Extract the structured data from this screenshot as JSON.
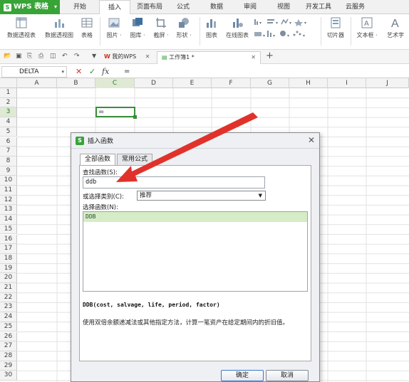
{
  "app": {
    "name": "WPS 表格",
    "brand_color": "#38a336",
    "menu": [
      "开始",
      "插入",
      "页面布局",
      "公式",
      "数据",
      "审阅",
      "视图",
      "开发工具",
      "云服务"
    ],
    "active_menu": "插入"
  },
  "ribbon": {
    "items": [
      {
        "label": "数据透视表",
        "icon": "pivot-table-icon"
      },
      {
        "label": "数据透视图",
        "icon": "pivot-chart-icon"
      },
      {
        "label": "表格",
        "icon": "table-icon"
      },
      {
        "label": "图片 ·",
        "icon": "picture-icon"
      },
      {
        "label": "图库 ·",
        "icon": "gallery-icon"
      },
      {
        "label": "截屏 ·",
        "icon": "screenshot-icon"
      },
      {
        "label": "形状 ·",
        "icon": "shapes-icon"
      },
      {
        "label": "图表",
        "icon": "chart-icon"
      },
      {
        "label": "在线图表",
        "icon": "online-chart-icon"
      },
      {
        "label": "切片器",
        "icon": "slicer-icon"
      },
      {
        "label": "文本框 ·",
        "icon": "textbox-icon"
      },
      {
        "label": "艺术字",
        "icon": "wordart-icon"
      }
    ]
  },
  "tabs": {
    "wps_tab": "我的WPS",
    "doc_tab": "工作簿1 *",
    "add": "+"
  },
  "formula_bar": {
    "name_box": "DELTA",
    "cancel_icon": "✕",
    "enter_icon": "✓",
    "fx_icon": "fx",
    "content": "="
  },
  "sheet": {
    "columns": [
      "A",
      "B",
      "C",
      "D",
      "E",
      "F",
      "G",
      "H",
      "I",
      "J"
    ],
    "selected_column": "C",
    "rows": [
      "1",
      "2",
      "3",
      "4",
      "5",
      "6",
      "7",
      "8",
      "9",
      "10",
      "11",
      "12",
      "13",
      "14",
      "15",
      "16",
      "17",
      "18",
      "19",
      "20",
      "21",
      "22",
      "23",
      "24",
      "25",
      "26",
      "27",
      "28",
      "29",
      "30"
    ],
    "selected_row": "3",
    "active_cell_value": "="
  },
  "dialog": {
    "title": "插入函数",
    "tabs": [
      "全部函数",
      "常用公式"
    ],
    "search_label": "查找函数(S):",
    "search_value": "ddb",
    "category_label": "或选择类别(C):",
    "category_value": "推荐",
    "list_label": "选择函数(N):",
    "functions": [
      "DDB"
    ],
    "signature": "DDB(cost, salvage, life, period, factor)",
    "description": "使用双倍余额递减法或其他指定方法，计算一笔资产在给定期间内的折旧值。",
    "ok": "确定",
    "cancel": "取消"
  },
  "annotation": {
    "arrow_color": "#e0322b"
  }
}
